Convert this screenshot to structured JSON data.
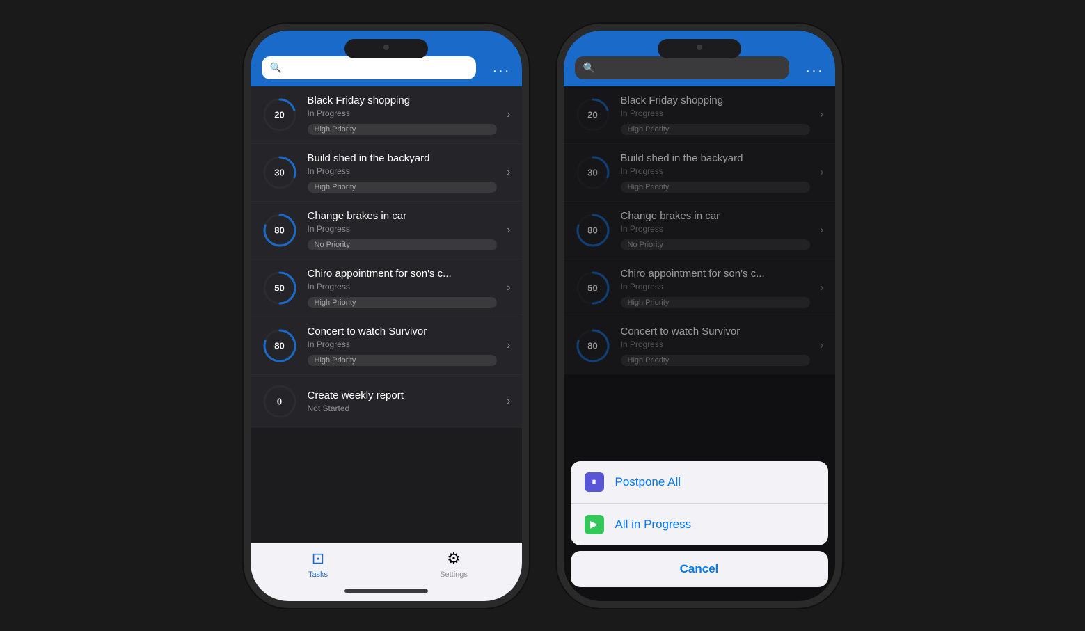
{
  "phone1": {
    "search": {
      "placeholder": ""
    },
    "tasks": [
      {
        "id": "t1",
        "title": "Black Friday shopping",
        "status": "In Progress",
        "priority": "High Priority",
        "progress": 20,
        "circumference": 138.2,
        "offset": 110.56
      },
      {
        "id": "t2",
        "title": "Build shed in the backyard",
        "status": "In Progress",
        "priority": "High Priority",
        "progress": 30,
        "circumference": 138.2,
        "offset": 96.74
      },
      {
        "id": "t3",
        "title": "Change brakes in car",
        "status": "In Progress",
        "priority": "No Priority",
        "progress": 80,
        "circumference": 138.2,
        "offset": 27.64
      },
      {
        "id": "t4",
        "title": "Chiro appointment for son's c...",
        "status": "In Progress",
        "priority": "High Priority",
        "progress": 50,
        "circumference": 138.2,
        "offset": 69.1
      },
      {
        "id": "t5",
        "title": "Concert to watch Survivor",
        "status": "In Progress",
        "priority": "High Priority",
        "progress": 80,
        "circumference": 138.2,
        "offset": 27.64
      },
      {
        "id": "t6",
        "title": "Create weekly report",
        "status": "Not Started",
        "priority": "",
        "progress": 0,
        "circumference": 138.2,
        "offset": 138.2
      }
    ],
    "tabs": [
      {
        "id": "tasks",
        "label": "Tasks",
        "icon": "T",
        "active": true
      },
      {
        "id": "settings",
        "label": "Settings",
        "icon": "⚙",
        "active": false
      }
    ]
  },
  "phone2": {
    "search": {
      "placeholder": ""
    },
    "actionSheet": {
      "items": [
        {
          "id": "postpone",
          "icon": "⏸",
          "label": "Postpone All",
          "iconStyle": "pause"
        },
        {
          "id": "progress",
          "icon": "▶",
          "label": "All in Progress",
          "iconStyle": "play"
        }
      ],
      "cancel": "Cancel"
    }
  }
}
